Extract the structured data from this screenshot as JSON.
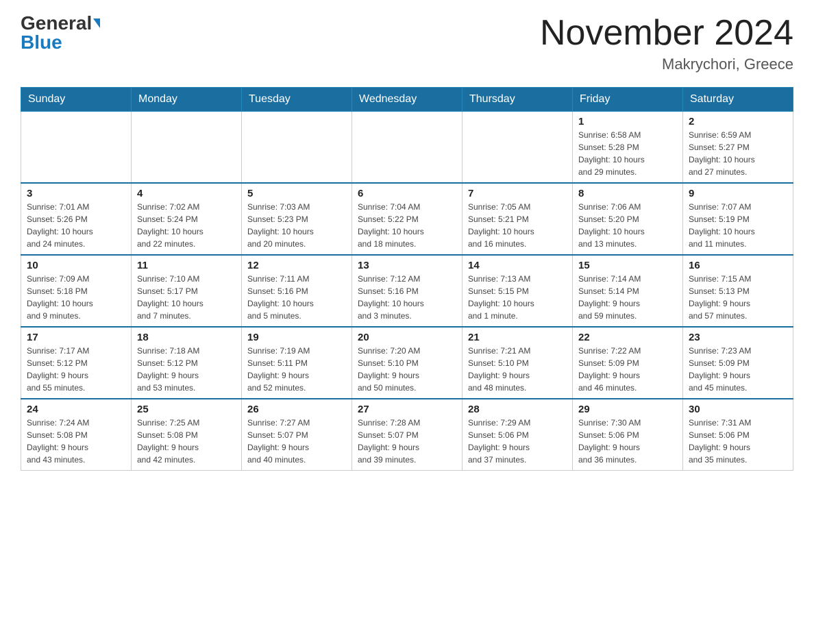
{
  "header": {
    "logo_general": "General",
    "logo_blue": "Blue",
    "month_title": "November 2024",
    "location": "Makrychori, Greece"
  },
  "weekdays": [
    "Sunday",
    "Monday",
    "Tuesday",
    "Wednesday",
    "Thursday",
    "Friday",
    "Saturday"
  ],
  "weeks": [
    [
      {
        "day": "",
        "info": ""
      },
      {
        "day": "",
        "info": ""
      },
      {
        "day": "",
        "info": ""
      },
      {
        "day": "",
        "info": ""
      },
      {
        "day": "",
        "info": ""
      },
      {
        "day": "1",
        "info": "Sunrise: 6:58 AM\nSunset: 5:28 PM\nDaylight: 10 hours\nand 29 minutes."
      },
      {
        "day": "2",
        "info": "Sunrise: 6:59 AM\nSunset: 5:27 PM\nDaylight: 10 hours\nand 27 minutes."
      }
    ],
    [
      {
        "day": "3",
        "info": "Sunrise: 7:01 AM\nSunset: 5:26 PM\nDaylight: 10 hours\nand 24 minutes."
      },
      {
        "day": "4",
        "info": "Sunrise: 7:02 AM\nSunset: 5:24 PM\nDaylight: 10 hours\nand 22 minutes."
      },
      {
        "day": "5",
        "info": "Sunrise: 7:03 AM\nSunset: 5:23 PM\nDaylight: 10 hours\nand 20 minutes."
      },
      {
        "day": "6",
        "info": "Sunrise: 7:04 AM\nSunset: 5:22 PM\nDaylight: 10 hours\nand 18 minutes."
      },
      {
        "day": "7",
        "info": "Sunrise: 7:05 AM\nSunset: 5:21 PM\nDaylight: 10 hours\nand 16 minutes."
      },
      {
        "day": "8",
        "info": "Sunrise: 7:06 AM\nSunset: 5:20 PM\nDaylight: 10 hours\nand 13 minutes."
      },
      {
        "day": "9",
        "info": "Sunrise: 7:07 AM\nSunset: 5:19 PM\nDaylight: 10 hours\nand 11 minutes."
      }
    ],
    [
      {
        "day": "10",
        "info": "Sunrise: 7:09 AM\nSunset: 5:18 PM\nDaylight: 10 hours\nand 9 minutes."
      },
      {
        "day": "11",
        "info": "Sunrise: 7:10 AM\nSunset: 5:17 PM\nDaylight: 10 hours\nand 7 minutes."
      },
      {
        "day": "12",
        "info": "Sunrise: 7:11 AM\nSunset: 5:16 PM\nDaylight: 10 hours\nand 5 minutes."
      },
      {
        "day": "13",
        "info": "Sunrise: 7:12 AM\nSunset: 5:16 PM\nDaylight: 10 hours\nand 3 minutes."
      },
      {
        "day": "14",
        "info": "Sunrise: 7:13 AM\nSunset: 5:15 PM\nDaylight: 10 hours\nand 1 minute."
      },
      {
        "day": "15",
        "info": "Sunrise: 7:14 AM\nSunset: 5:14 PM\nDaylight: 9 hours\nand 59 minutes."
      },
      {
        "day": "16",
        "info": "Sunrise: 7:15 AM\nSunset: 5:13 PM\nDaylight: 9 hours\nand 57 minutes."
      }
    ],
    [
      {
        "day": "17",
        "info": "Sunrise: 7:17 AM\nSunset: 5:12 PM\nDaylight: 9 hours\nand 55 minutes."
      },
      {
        "day": "18",
        "info": "Sunrise: 7:18 AM\nSunset: 5:12 PM\nDaylight: 9 hours\nand 53 minutes."
      },
      {
        "day": "19",
        "info": "Sunrise: 7:19 AM\nSunset: 5:11 PM\nDaylight: 9 hours\nand 52 minutes."
      },
      {
        "day": "20",
        "info": "Sunrise: 7:20 AM\nSunset: 5:10 PM\nDaylight: 9 hours\nand 50 minutes."
      },
      {
        "day": "21",
        "info": "Sunrise: 7:21 AM\nSunset: 5:10 PM\nDaylight: 9 hours\nand 48 minutes."
      },
      {
        "day": "22",
        "info": "Sunrise: 7:22 AM\nSunset: 5:09 PM\nDaylight: 9 hours\nand 46 minutes."
      },
      {
        "day": "23",
        "info": "Sunrise: 7:23 AM\nSunset: 5:09 PM\nDaylight: 9 hours\nand 45 minutes."
      }
    ],
    [
      {
        "day": "24",
        "info": "Sunrise: 7:24 AM\nSunset: 5:08 PM\nDaylight: 9 hours\nand 43 minutes."
      },
      {
        "day": "25",
        "info": "Sunrise: 7:25 AM\nSunset: 5:08 PM\nDaylight: 9 hours\nand 42 minutes."
      },
      {
        "day": "26",
        "info": "Sunrise: 7:27 AM\nSunset: 5:07 PM\nDaylight: 9 hours\nand 40 minutes."
      },
      {
        "day": "27",
        "info": "Sunrise: 7:28 AM\nSunset: 5:07 PM\nDaylight: 9 hours\nand 39 minutes."
      },
      {
        "day": "28",
        "info": "Sunrise: 7:29 AM\nSunset: 5:06 PM\nDaylight: 9 hours\nand 37 minutes."
      },
      {
        "day": "29",
        "info": "Sunrise: 7:30 AM\nSunset: 5:06 PM\nDaylight: 9 hours\nand 36 minutes."
      },
      {
        "day": "30",
        "info": "Sunrise: 7:31 AM\nSunset: 5:06 PM\nDaylight: 9 hours\nand 35 minutes."
      }
    ]
  ]
}
